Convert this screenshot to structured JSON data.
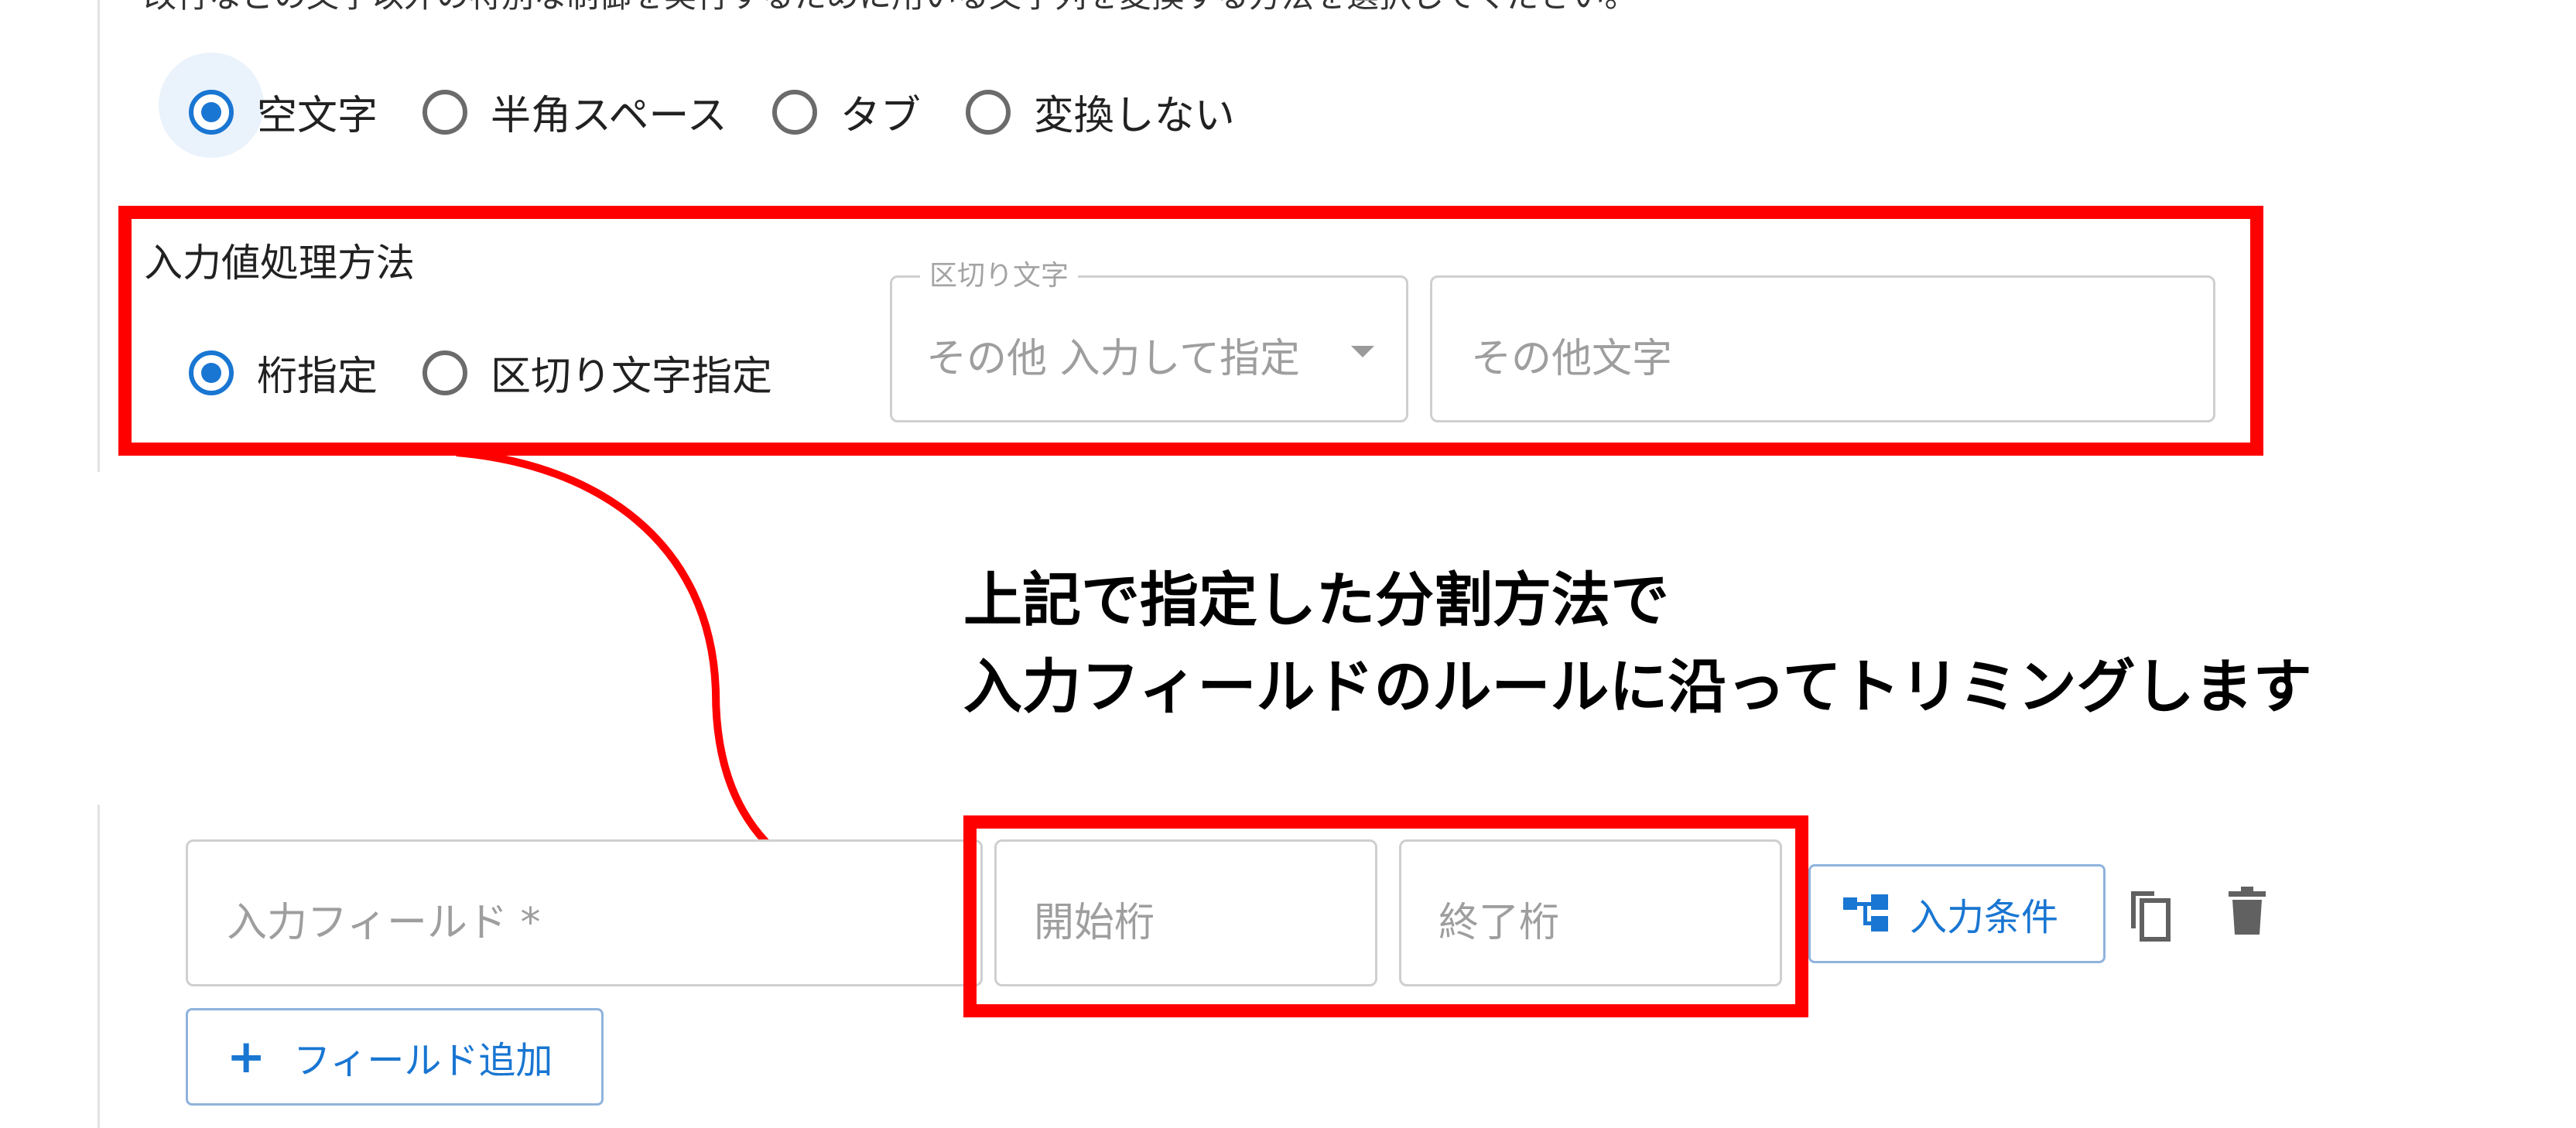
{
  "instruction_text": "改行などの文字以外の特別な制御を実行するために用いる文字列を変換する方法を選択してください。",
  "conversion_options": [
    {
      "label": "空文字",
      "checked": true
    },
    {
      "label": "半角スペース",
      "checked": false
    },
    {
      "label": "タブ",
      "checked": false
    },
    {
      "label": "変換しない",
      "checked": false
    }
  ],
  "input_processing": {
    "label": "入力値処理方法",
    "options": [
      {
        "label": "桁指定",
        "checked": true
      },
      {
        "label": "区切り文字指定",
        "checked": false
      }
    ],
    "delimiter_select": {
      "label": "区切り文字",
      "value": "その他 入力して指定"
    },
    "other_char_placeholder": "その他文字"
  },
  "annotation": {
    "line1": "上記で指定した分割方法で",
    "line2": "入力フィールドのルールに沿ってトリミングします"
  },
  "field_row": {
    "field_placeholder": "入力フィールド *",
    "start_placeholder": "開始桁",
    "end_placeholder": "終了桁",
    "condition_button": "入力条件"
  },
  "add_field_button": "フィールド追加",
  "colors": {
    "accent": "#1976d2",
    "highlight": "#ff0000"
  },
  "icons": [
    "radio-button",
    "dropdown-caret",
    "tree-structure-icon",
    "copy-icon",
    "trash-icon",
    "plus-icon",
    "curved-arrow"
  ]
}
